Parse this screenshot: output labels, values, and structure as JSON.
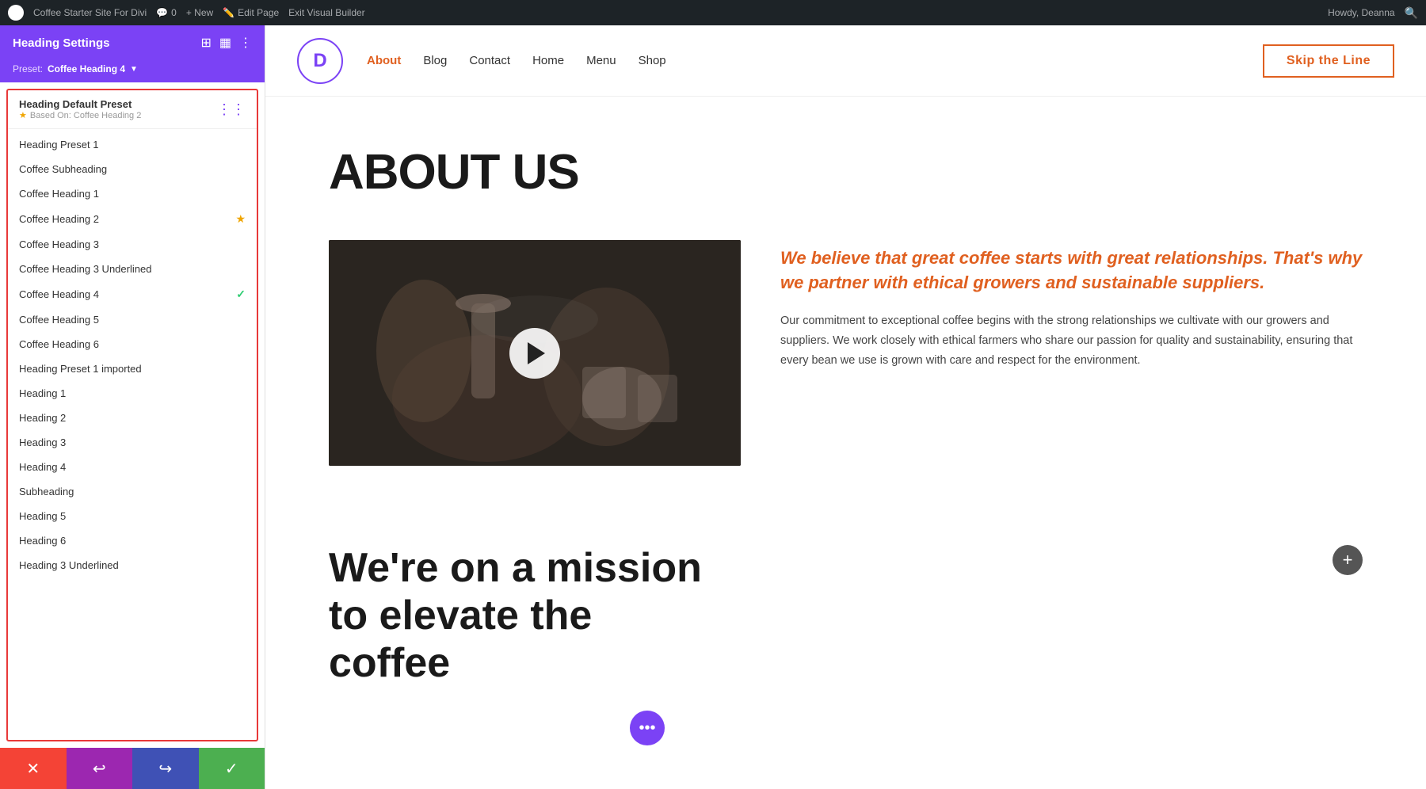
{
  "admin_bar": {
    "site_name": "Coffee Starter Site For Divi",
    "comment_count": "0",
    "new_label": "+ New",
    "edit_page_label": "Edit Page",
    "exit_builder_label": "Exit Visual Builder",
    "howdy_label": "Howdy, Deanna"
  },
  "panel": {
    "title": "Heading Settings",
    "preset_label": "Preset: Coffee Heading 4",
    "default_section": {
      "title": "Heading Default Preset",
      "based_on": "Based On: Coffee Heading 2"
    },
    "presets": [
      {
        "name": "Heading Preset 1",
        "icon": null
      },
      {
        "name": "Coffee Subheading",
        "icon": null
      },
      {
        "name": "Coffee Heading 1",
        "icon": null
      },
      {
        "name": "Coffee Heading 2",
        "icon": "star"
      },
      {
        "name": "Coffee Heading 3",
        "icon": null
      },
      {
        "name": "Coffee Heading 3 Underlined",
        "icon": null
      },
      {
        "name": "Coffee Heading 4",
        "icon": "check"
      },
      {
        "name": "Coffee Heading 5",
        "icon": null
      },
      {
        "name": "Coffee Heading 6",
        "icon": null
      },
      {
        "name": "Heading Preset 1 imported",
        "icon": null
      },
      {
        "name": "Heading 1",
        "icon": null
      },
      {
        "name": "Heading 2",
        "icon": null
      },
      {
        "name": "Heading 3",
        "icon": null
      },
      {
        "name": "Heading 4",
        "icon": null
      },
      {
        "name": "Subheading",
        "icon": null
      },
      {
        "name": "Heading 5",
        "icon": null
      },
      {
        "name": "Heading 6",
        "icon": null
      },
      {
        "name": "Heading 3 Underlined",
        "icon": null
      }
    ],
    "actions": {
      "cancel_icon": "✕",
      "undo_icon": "↩",
      "redo_icon": "↪",
      "confirm_icon": "✓"
    }
  },
  "site_header": {
    "logo_letter": "D",
    "nav_items": [
      {
        "label": "About",
        "active": true
      },
      {
        "label": "Blog",
        "active": false
      },
      {
        "label": "Contact",
        "active": false
      },
      {
        "label": "Home",
        "active": false
      },
      {
        "label": "Menu",
        "active": false
      },
      {
        "label": "Shop",
        "active": false
      }
    ],
    "cta_label": "Skip the Line"
  },
  "page": {
    "title": "ABOUT US",
    "video_alt": "Coffee brewing video",
    "quote": "We believe that great coffee starts with great relationships. That's why we partner with ethical growers and sustainable suppliers.",
    "body_text": "Our commitment to exceptional coffee begins with the strong relationships we cultivate with our growers and suppliers. We work closely with ethical farmers who share our passion for quality and sustainability, ensuring that every bean we use is grown with care and respect for the environment.",
    "mission_title": "We're on a mission to elevate the coffee"
  }
}
